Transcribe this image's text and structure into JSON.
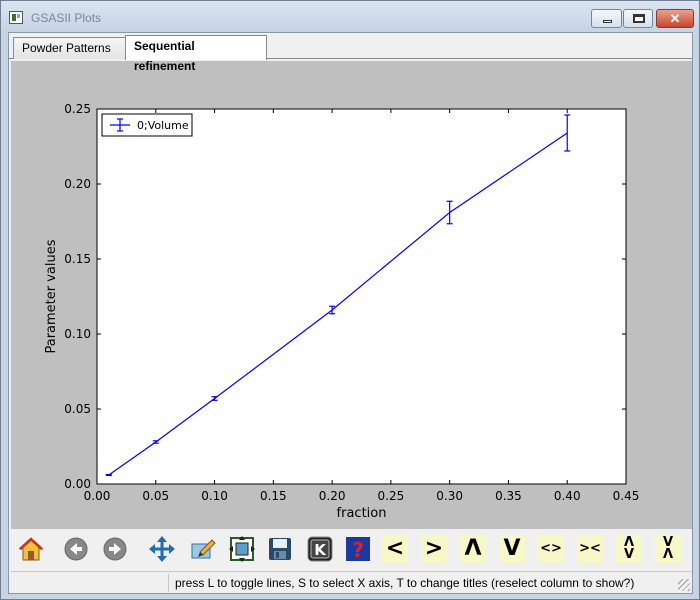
{
  "window": {
    "title": "GSASII Plots"
  },
  "tabs": [
    {
      "label": "Powder Patterns",
      "active": false
    },
    {
      "label": "Sequential refinement",
      "active": true
    }
  ],
  "chart_data": {
    "type": "line",
    "xlabel": "fraction",
    "ylabel": "Parameter values",
    "xlim": [
      0.0,
      0.45
    ],
    "ylim": [
      0.0,
      0.25
    ],
    "xticks": [
      "0.00",
      "0.05",
      "0.10",
      "0.15",
      "0.20",
      "0.25",
      "0.30",
      "0.35",
      "0.40",
      "0.45"
    ],
    "yticks": [
      "0.00",
      "0.05",
      "0.10",
      "0.15",
      "0.20",
      "0.25"
    ],
    "grid": false,
    "legend_position": "top-left",
    "series": [
      {
        "name": "0;Volume",
        "color": "#0000ff",
        "x": [
          0.01,
          0.05,
          0.1,
          0.2,
          0.3,
          0.4
        ],
        "y": [
          0.006,
          0.028,
          0.057,
          0.116,
          0.181,
          0.234
        ],
        "err": [
          0.0003,
          0.0008,
          0.0012,
          0.0025,
          0.0075,
          0.012
        ]
      }
    ]
  },
  "toolbar": {
    "buttons": [
      {
        "name": "home-icon",
        "kind": "icon"
      },
      {
        "name": "back-icon",
        "kind": "icon"
      },
      {
        "name": "forward-icon",
        "kind": "icon"
      },
      {
        "name": "pan-icon",
        "kind": "icon"
      },
      {
        "name": "zoom-icon",
        "kind": "icon"
      },
      {
        "name": "configure-subplots-icon",
        "kind": "icon"
      },
      {
        "name": "save-icon",
        "kind": "icon"
      },
      {
        "name": "keyboard-icon",
        "kind": "icon"
      },
      {
        "name": "help-icon",
        "kind": "icon"
      }
    ],
    "glyphs": {
      "left": "<",
      "right": ">",
      "up": "Λ",
      "down": "V",
      "expand_x": "<>",
      "shrink_x": "><",
      "expand_y": "Λ\nV",
      "shrink_y": "V\nΛ"
    }
  },
  "status": {
    "text": "press L to toggle lines, S to select X axis, T to change titles (reselect column to show?)"
  }
}
